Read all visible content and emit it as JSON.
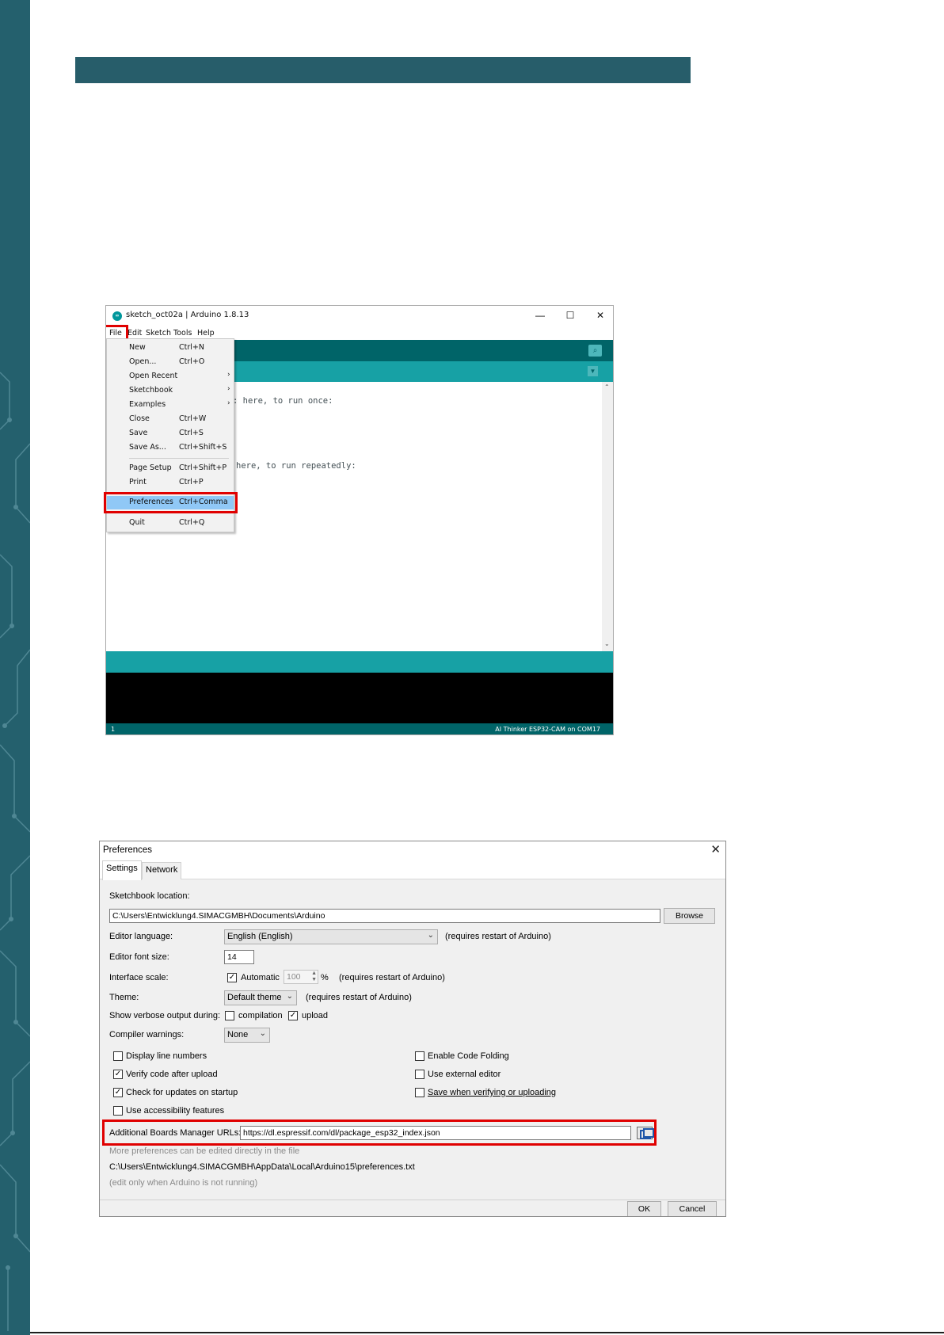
{
  "ide": {
    "logo_text": "∞",
    "window_title": "sketch_oct02a | Arduino 1.8.13",
    "menu": [
      "File",
      "Edit",
      "Sketch",
      "Tools",
      "Help"
    ],
    "code": [
      ": here, to run once:",
      "here, to run repeatedly:"
    ],
    "line_number": "1",
    "board_status": "AI Thinker ESP32-CAM on COM17",
    "file_menu": [
      {
        "label": "New",
        "shortcut": "Ctrl+N"
      },
      {
        "label": "Open...",
        "shortcut": "Ctrl+O"
      },
      {
        "label": "Open Recent",
        "shortcut": "",
        "arrow": "›"
      },
      {
        "label": "Sketchbook",
        "shortcut": "",
        "arrow": "›"
      },
      {
        "label": "Examples",
        "shortcut": "",
        "arrow": "›"
      },
      {
        "label": "Close",
        "shortcut": "Ctrl+W"
      },
      {
        "label": "Save",
        "shortcut": "Ctrl+S"
      },
      {
        "label": "Save As...",
        "shortcut": "Ctrl+Shift+S"
      },
      {
        "label": "Page Setup",
        "shortcut": "Ctrl+Shift+P"
      },
      {
        "label": "Print",
        "shortcut": "Ctrl+P"
      },
      {
        "label": "Preferences",
        "shortcut": "Ctrl+Comma"
      },
      {
        "label": "Quit",
        "shortcut": "Ctrl+Q"
      }
    ]
  },
  "prefs": {
    "title": "Preferences",
    "close": "✕",
    "tabs": [
      "Settings",
      "Network"
    ],
    "sketchbook_label": "Sketchbook location:",
    "sketchbook_path": "C:\\Users\\Entwicklung4.SIMACGMBH\\Documents\\Arduino",
    "browse": "Browse",
    "language_label": "Editor language:",
    "language_value": "English (English)",
    "restart_note": "(requires restart of Arduino)",
    "font_size_label": "Editor font size:",
    "font_size_value": "14",
    "scale_label": "Interface scale:",
    "scale_automatic": "Automatic",
    "scale_value": "100",
    "scale_unit": "%",
    "theme_label": "Theme:",
    "theme_value": "Default theme",
    "verbose_label": "Show verbose output during:",
    "verbose_compilation": "compilation",
    "verbose_upload": "upload",
    "warnings_label": "Compiler warnings:",
    "warnings_value": "None",
    "options_left": [
      {
        "label": "Display line numbers",
        "checked": false
      },
      {
        "label": "Verify code after upload",
        "checked": true
      },
      {
        "label": "Check for updates on startup",
        "checked": true
      },
      {
        "label": "Use accessibility features",
        "checked": false
      }
    ],
    "options_right": [
      {
        "label": "Enable Code Folding",
        "checked": false
      },
      {
        "label": "Use external editor",
        "checked": false
      },
      {
        "label": "Save when verifying or uploading",
        "checked": false
      }
    ],
    "boards_url_label": "Additional Boards Manager URLs:",
    "boards_url_value": "https://dl.espressif.com/dl/package_esp32_index.json",
    "more_prefs_note": "More preferences can be edited directly in the file",
    "prefs_file_path": "C:\\Users\\Entwicklung4.SIMACGMBH\\AppData\\Local\\Arduino15\\preferences.txt",
    "edit_note": "(edit only when Arduino is not running)",
    "ok": "OK",
    "cancel": "Cancel"
  },
  "colors": {
    "sidebar": "#24606d",
    "header_bar": "#275d6a",
    "arduino_dark": "#006468",
    "arduino_teal": "#17a1a5",
    "highlight": "#e00000",
    "menu_selected": "#90c8f6"
  }
}
